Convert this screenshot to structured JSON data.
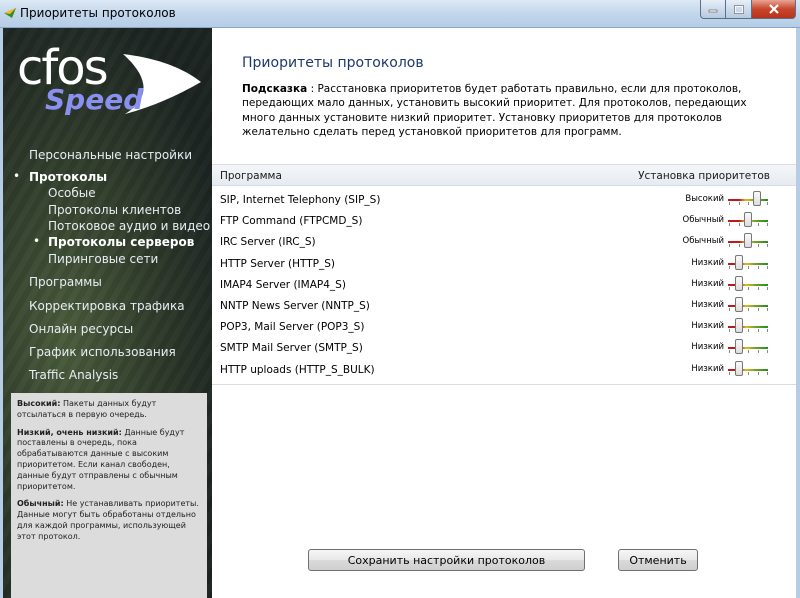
{
  "window": {
    "title": "Приоритеты протоколов"
  },
  "logo": {
    "main": "cfos",
    "sub": "Speed"
  },
  "nav": {
    "personal": "Персональные настройки",
    "protocols": "Протоколы",
    "special": "Особые",
    "client_protocols": "Протоколы клиентов",
    "streaming": "Потоковое аудио и видео",
    "server_protocols": "Протоколы серверов",
    "p2p": "Пиринговые сети",
    "programs": "Программы",
    "traffic_shaping": "Корректировка трафика",
    "online_resources": "Онлайн ресурсы",
    "usage_graph": "График использования",
    "traffic_analysis": "Traffic Analysis"
  },
  "legend": {
    "high_label": "Высокий:",
    "high_text": " Пакеты данных будут отсылаться в первую очередь.",
    "low_label": "Низкий, очень низкий:",
    "low_text": " Данные будут поставлены в очередь, пока обрабатываются данные с высоким приоритетом. Если канал свободен, данные будут отправлены с обычным приоритетом.",
    "normal_label": "Обычный:",
    "normal_text": " Не устанавливать приоритеты. Данные могут быть обработаны отдельно для каждой программы, использующей этот протокол."
  },
  "main": {
    "title": "Приоритеты протоколов",
    "hint_label": "Подсказка",
    "hint_text": " : Расстановка приоритетов будет работать правильно, если для протоколов, передающих мало данных, установить высокий приоритет. Для протоколов, передающих много данных установите низкий приоритет. Установку приоритетов для протоколов желательно сделать перед установкой приоритетов для программ.",
    "col_program": "Программа",
    "col_priority": "Установка приоритетов"
  },
  "rows": [
    {
      "name": "SIP, Internet Telephony (SIP_S)",
      "priority": "Высокий",
      "level": 0.75
    },
    {
      "name": "FTP Command (FTPCMD_S)",
      "priority": "Обычный",
      "level": 0.5
    },
    {
      "name": "IRC Server (IRC_S)",
      "priority": "Обычный",
      "level": 0.5
    },
    {
      "name": "HTTP Server (HTTP_S)",
      "priority": "Низкий",
      "level": 0.25
    },
    {
      "name": "IMAP4 Server (IMAP4_S)",
      "priority": "Низкий",
      "level": 0.25
    },
    {
      "name": "NNTP News Server (NNTP_S)",
      "priority": "Низкий",
      "level": 0.25
    },
    {
      "name": "POP3, Mail Server (POP3_S)",
      "priority": "Низкий",
      "level": 0.25
    },
    {
      "name": "SMTP Mail Server (SMTP_S)",
      "priority": "Низкий",
      "level": 0.25
    },
    {
      "name": "HTTP uploads (HTTP_S_BULK)",
      "priority": "Низкий",
      "level": 0.25
    }
  ],
  "buttons": {
    "save": "Сохранить настройки протоколов",
    "cancel": "Отменить"
  }
}
